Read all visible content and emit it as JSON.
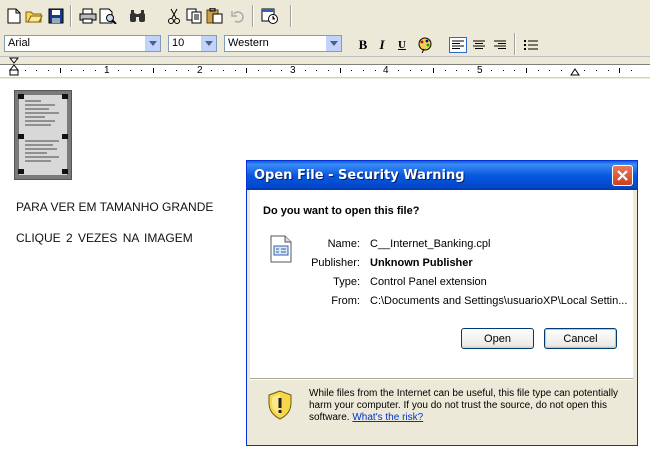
{
  "toolbar": {
    "font_name": "Arial",
    "font_size": "10",
    "charset": "Western",
    "ruler_numbers": [
      "1",
      "2",
      "3",
      "4",
      "5"
    ]
  },
  "document": {
    "line1": "PARA VER EM TAMANHO GRANDE",
    "line2": "CLIQUE  2  VEZES  NA  IMAGEM"
  },
  "dialog": {
    "title": "Open File - Security Warning",
    "question": "Do you want to open this file?",
    "rows": [
      {
        "label": "Name:",
        "value": "C__Internet_Banking.cpl"
      },
      {
        "label": "Publisher:",
        "value": "Unknown Publisher"
      },
      {
        "label": "Type:",
        "value": "Control Panel extension"
      },
      {
        "label": "From:",
        "value": "C:\\Documents and Settings\\usuarioXP\\Local Settin..."
      }
    ],
    "open_label": "Open",
    "cancel_label": "Cancel",
    "warning_text": "While files from the Internet can be useful, this file type can potentially harm your computer. If you do not trust the source, do not open this software.",
    "risk_link": "What's the risk?"
  },
  "colors": {
    "titlebar": "#0858e0",
    "dialog_bg": "#ece9d8",
    "link": "#0033cc"
  }
}
